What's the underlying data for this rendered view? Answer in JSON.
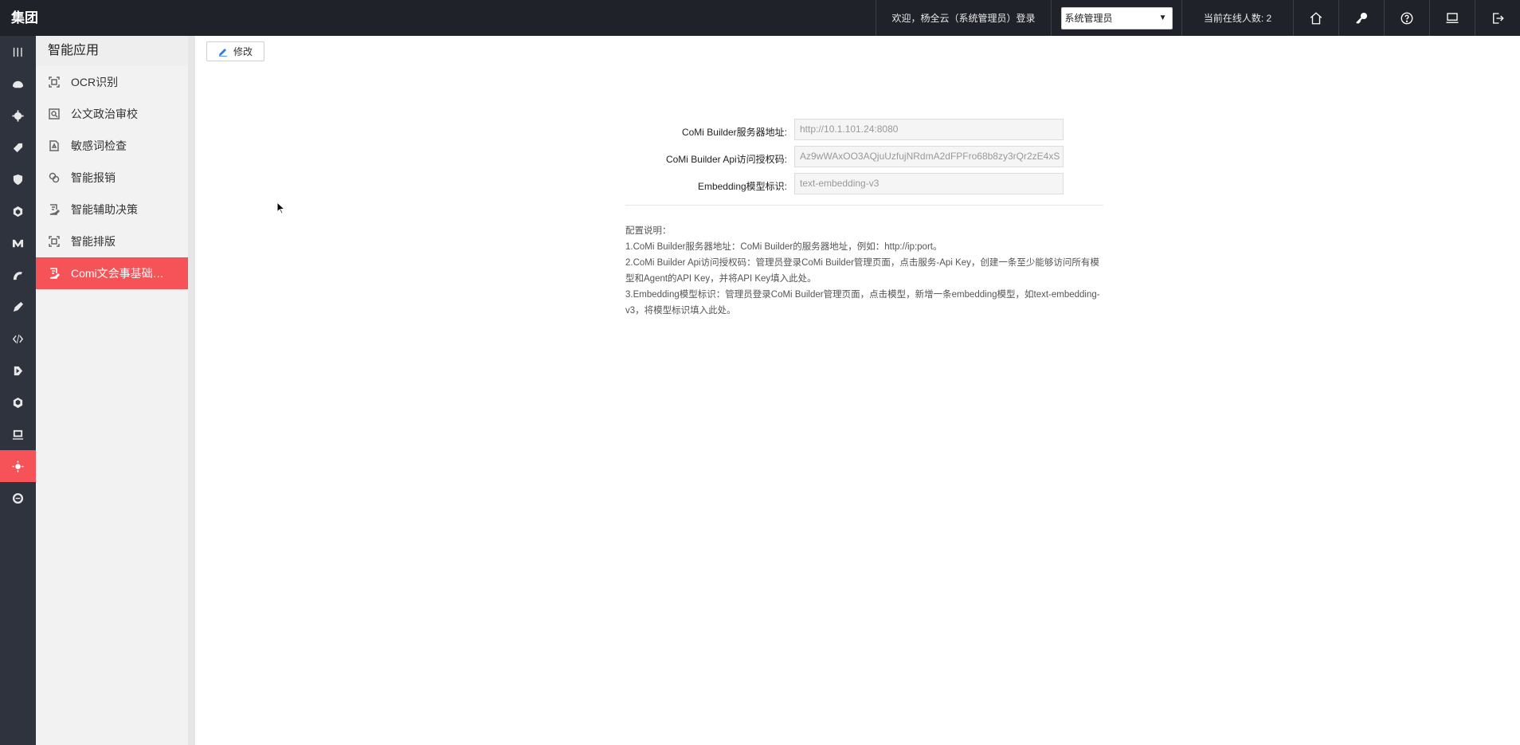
{
  "header": {
    "brand": "集团",
    "welcome": "欢迎，杨全云（系统管理员）登录",
    "role_selected": "系统管理员",
    "online": "当前在线人数: 2",
    "icons": [
      "home-icon",
      "key-icon",
      "help-icon",
      "monitor-icon",
      "logout-icon"
    ]
  },
  "rail": {
    "icons": [
      "dashboard-icon",
      "gear-icon",
      "tag-icon",
      "shield-check-icon",
      "hexagon-icon",
      "m-logo-icon",
      "chart-icon",
      "pen-icon",
      "code-icon",
      "play-icon",
      "cube-icon",
      "monitor-icon",
      "bulb-icon",
      "link-icon"
    ],
    "active_index": 12
  },
  "sidebar": {
    "title": "智能应用",
    "items": [
      {
        "label": "OCR识别",
        "icon": "scan-icon"
      },
      {
        "label": "公文政治审校",
        "icon": "search-doc-icon"
      },
      {
        "label": "敏感词检查",
        "icon": "warning-doc-icon"
      },
      {
        "label": "智能报销",
        "icon": "coins-icon"
      },
      {
        "label": "智能辅助决策",
        "icon": "doc-edit-icon"
      },
      {
        "label": "智能排版",
        "icon": "scan-icon"
      },
      {
        "label": "Comi文会事基础配置",
        "icon": "doc-edit-icon"
      }
    ],
    "active_index": 6
  },
  "main": {
    "edit_label": "修改",
    "fields": [
      {
        "label": "CoMi Builder服务器地址:",
        "value": "http://10.1.101.24:8080"
      },
      {
        "label": "CoMi Builder Api访问授权码:",
        "value": "Az9wWAxOO3AQjuUzfujNRdmA2dFPFro68b8zy3rQr2zE4xS"
      },
      {
        "label": "Embedding模型标识:",
        "value": "text-embedding-v3"
      }
    ],
    "notes": [
      "配置说明：",
      "1.CoMi Builder服务器地址：CoMi Builder的服务器地址，例如：http://ip:port。",
      "2.CoMi Builder Api访问授权码：管理员登录CoMi Builder管理页面，点击服务-Api Key，创建一条至少能够访问所有模型和Agent的API Key，并将API Key填入此处。",
      "3.Embedding模型标识：管理员登录CoMi Builder管理页面，点击模型，新增一条embedding模型，如text-embedding-v3，将模型标识填入此处。"
    ]
  },
  "colors": {
    "topbar": "#1f2229",
    "rail": "#2e333d",
    "accent": "#f55357"
  }
}
